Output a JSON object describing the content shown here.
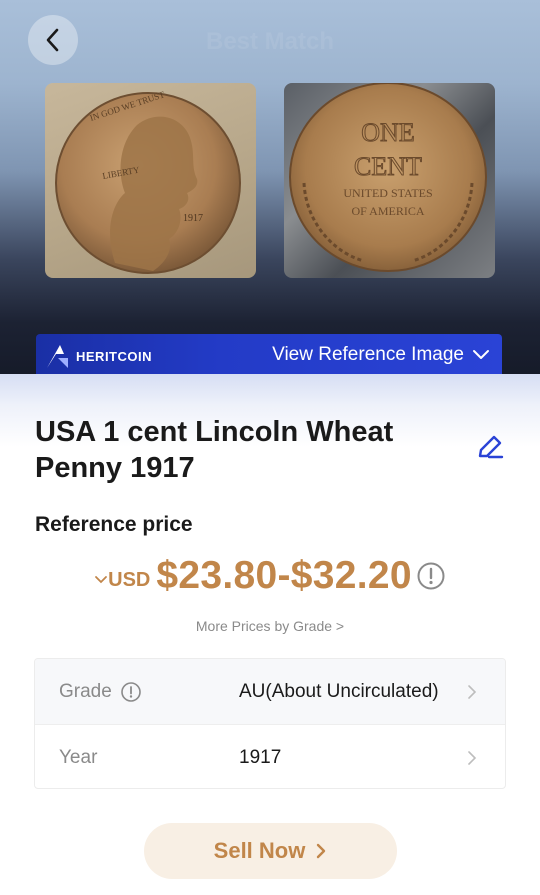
{
  "header": {
    "back_icon": "chevron-left-icon",
    "title": "Best Match"
  },
  "images": {
    "obverse": {
      "legend_top": "IN GOD WE TRUST",
      "legend_left": "LIBERTY",
      "date": "1917"
    },
    "reverse": {
      "line1": "ONE",
      "line2": "CENT",
      "line3": "UNITED STATES",
      "line4": "OF AMERICA"
    }
  },
  "reference_bar": {
    "brand": "HERITCOIN",
    "link_label": "View Reference Image",
    "link_icon": "chevron-down-icon"
  },
  "coin": {
    "title": "USA 1 cent  Lincoln Wheat Penny 1917",
    "edit_icon": "edit-pencil-icon"
  },
  "price": {
    "label": "Reference price",
    "currency": "USD",
    "range": "$23.80-$32.20",
    "more_link": "More Prices by Grade >",
    "accent_color": "#c1864a"
  },
  "details": [
    {
      "key": "Grade",
      "value": "AU(About Uncirculated)",
      "has_info": true
    },
    {
      "key": "Year",
      "value": "1917",
      "has_info": false
    }
  ],
  "actions": {
    "sell_label": "Sell Now"
  }
}
